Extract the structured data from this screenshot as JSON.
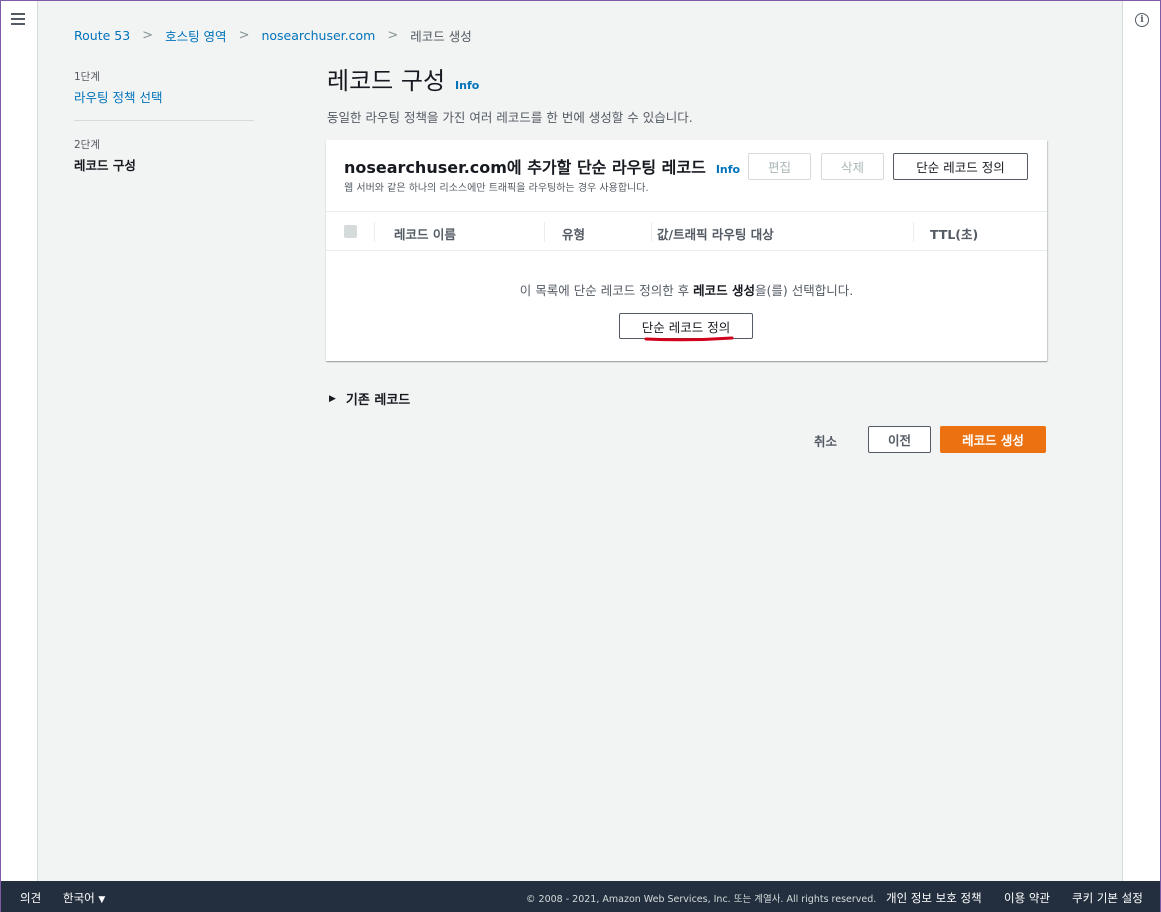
{
  "breadcrumb": {
    "items": [
      "Route 53",
      "호스팅 영역",
      "nosearchuser.com"
    ],
    "current": "레코드 생성"
  },
  "steps": {
    "step1_label": "1단계",
    "step1_title": "라우팅 정책 선택",
    "step2_label": "2단계",
    "step2_title": "레코드 구성"
  },
  "page": {
    "title": "레코드 구성",
    "info": "Info",
    "description": "동일한 라우팅 정책을 가진 여러 레코드를 한 번에 생성할 수 있습니다."
  },
  "panel": {
    "title": "nosearchuser.com에 추가할 단순 라우팅 레코드",
    "info": "Info",
    "subtitle": "웹 서버와 같은 하나의 리소스에만 트래픽을 라우팅하는 경우 사용합니다.",
    "edit_label": "편집",
    "delete_label": "삭제",
    "define_label": "단순 레코드 정의",
    "columns": [
      "레코드 이름",
      "유형",
      "값/트래픽 라우팅 대상",
      "TTL(초)"
    ],
    "empty_prefix": "이 목록에 단순 레코드 정의한 후 ",
    "empty_bold": "레코드 생성",
    "empty_suffix": "을(를) 선택합니다.",
    "empty_button": "단순 레코드 정의",
    "annotation_color": "#d0021b"
  },
  "expander": {
    "label": "기존 레코드"
  },
  "actions": {
    "cancel": "취소",
    "previous": "이전",
    "create": "레코드 생성",
    "create_color": "#ec7211"
  },
  "footer": {
    "feedback": "의견",
    "language": "한국어",
    "copyright": "© 2008 - 2021, Amazon Web Services, Inc. 또는 계열사. All rights reserved.",
    "privacy": "개인 정보 보호 정책",
    "terms": "이용 약관",
    "cookies": "쿠키 기본 설정"
  }
}
